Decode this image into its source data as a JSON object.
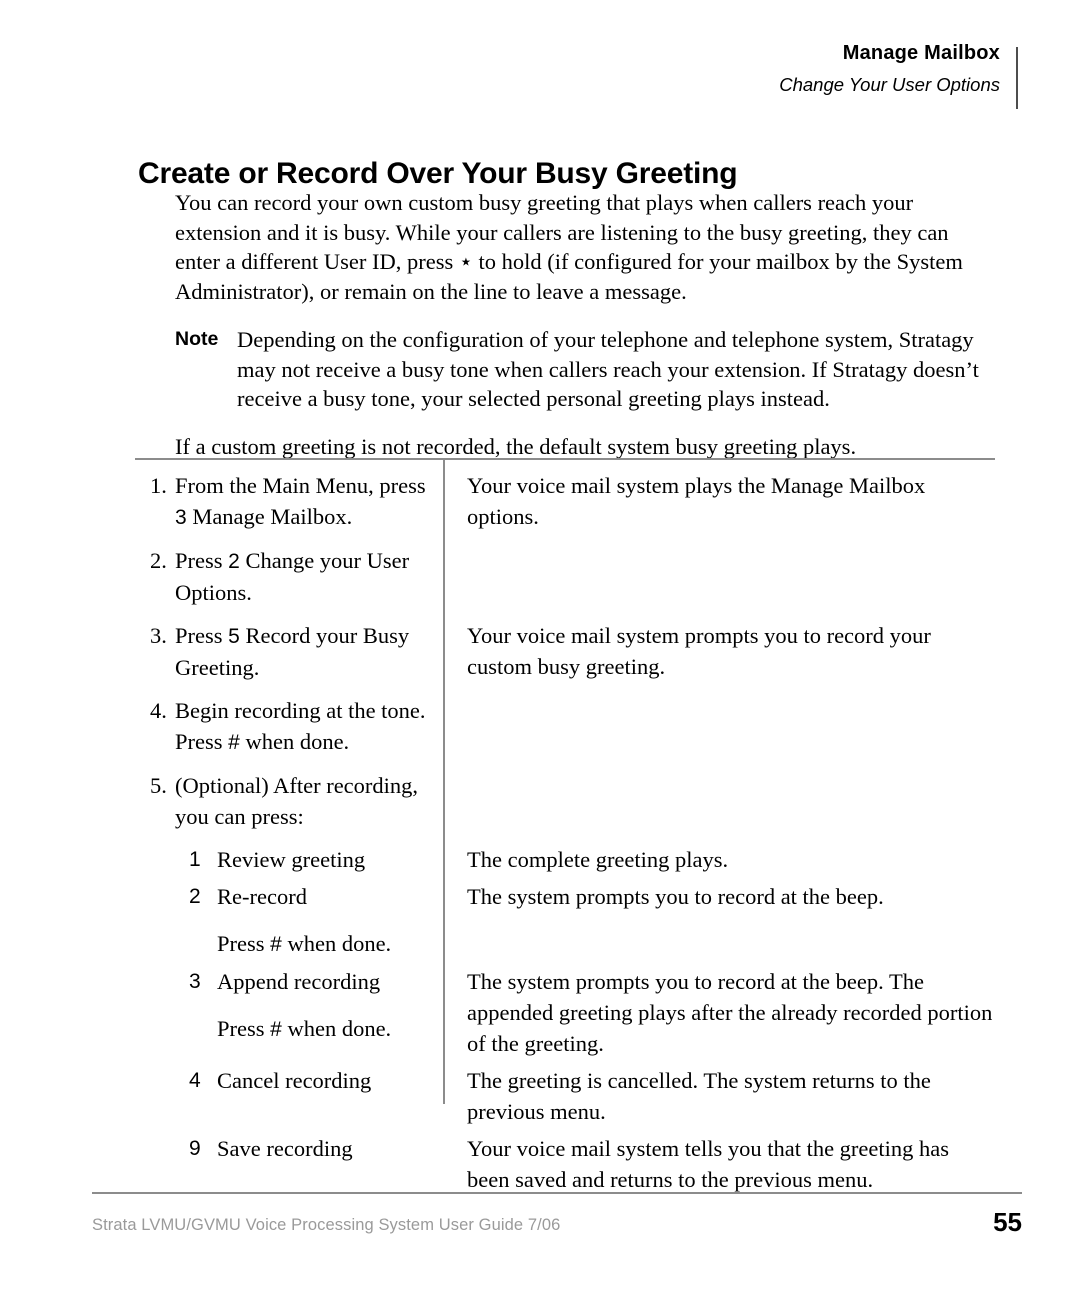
{
  "header": {
    "title": "Manage Mailbox",
    "subtitle": "Change Your User Options"
  },
  "page_title": "Create or Record Over Your Busy Greeting",
  "intro_paragraph": "You can record your own custom busy greeting that plays when callers reach your extension and it is busy. While your callers are listening to the busy greeting, they can enter a different User ID, press ⋆  to hold (if configured for your mailbox by the System Administrator), or remain on the line to leave a message.",
  "note": {
    "label": "Note",
    "text": "Depending on the configuration of your telephone and telephone system, Stratagy may not receive a busy tone when callers reach your extension. If Stratagy doesn’t receive a busy tone, your selected personal greeting plays instead."
  },
  "after_note_paragraph": "If a custom greeting is not recorded, the default system busy greeting plays.",
  "procedure": {
    "steps": [
      {
        "kind": "step",
        "number": "1.",
        "action_pre": "From the Main Menu, press ",
        "action_key": "3",
        "action_post": " Manage Mailbox.",
        "result": "Your voice mail system plays the Manage Mailbox options."
      },
      {
        "kind": "step",
        "number": "2.",
        "action_pre": "Press ",
        "action_key": "2",
        "action_post": " Change your User Options.",
        "result": ""
      },
      {
        "kind": "step",
        "number": "3.",
        "action_pre": "Press ",
        "action_key": "5",
        "action_post": " Record your Busy Greeting.",
        "result": "Your voice mail system prompts you to record your custom busy greeting."
      },
      {
        "kind": "step",
        "number": "4.",
        "action_pre": "Begin recording at the tone. Press ",
        "action_key": "#",
        "action_post": " when done.",
        "result": ""
      },
      {
        "kind": "step",
        "number": "5.",
        "action_pre": "(Optional) After recording, you can press:",
        "action_key": "",
        "action_post": "",
        "result": ""
      },
      {
        "kind": "substep",
        "number": "1",
        "action_pre": "Review greeting",
        "action_key": "",
        "action_post": "",
        "continuation": "",
        "result": "The complete greeting plays."
      },
      {
        "kind": "substep",
        "number": "2",
        "action_pre": "Re-record",
        "action_key": "",
        "action_post": "",
        "continuation_pre": "Press ",
        "continuation_key": "#",
        "continuation_post": " when done.",
        "result": "The system prompts you to record at the beep."
      },
      {
        "kind": "substep",
        "number": "3",
        "action_pre": "Append recording",
        "action_key": "",
        "action_post": "",
        "continuation_pre": "Press ",
        "continuation_key": "#",
        "continuation_post": "  when done.",
        "result": "The system prompts you to record at the beep. The appended greeting plays after the already recorded portion of the greeting."
      },
      {
        "kind": "substep",
        "number": "4",
        "action_pre": "Cancel recording",
        "action_key": "",
        "action_post": "",
        "continuation": "",
        "result": "The greeting is cancelled. The system returns to the previous menu."
      },
      {
        "kind": "substep",
        "number": "9",
        "action_pre": "Save recording",
        "action_key": "",
        "action_post": "",
        "continuation": "",
        "result": "Your voice mail system tells you that the greeting has been saved and returns to the previous menu."
      }
    ]
  },
  "footer": {
    "text": "Strata LVMU/GVMU Voice Processing System User Guide    7/06",
    "page_number": "55"
  },
  "colors": {
    "rule": "#8c8c8c",
    "footer_text": "#9a9a9a",
    "body_text": "#000000"
  }
}
